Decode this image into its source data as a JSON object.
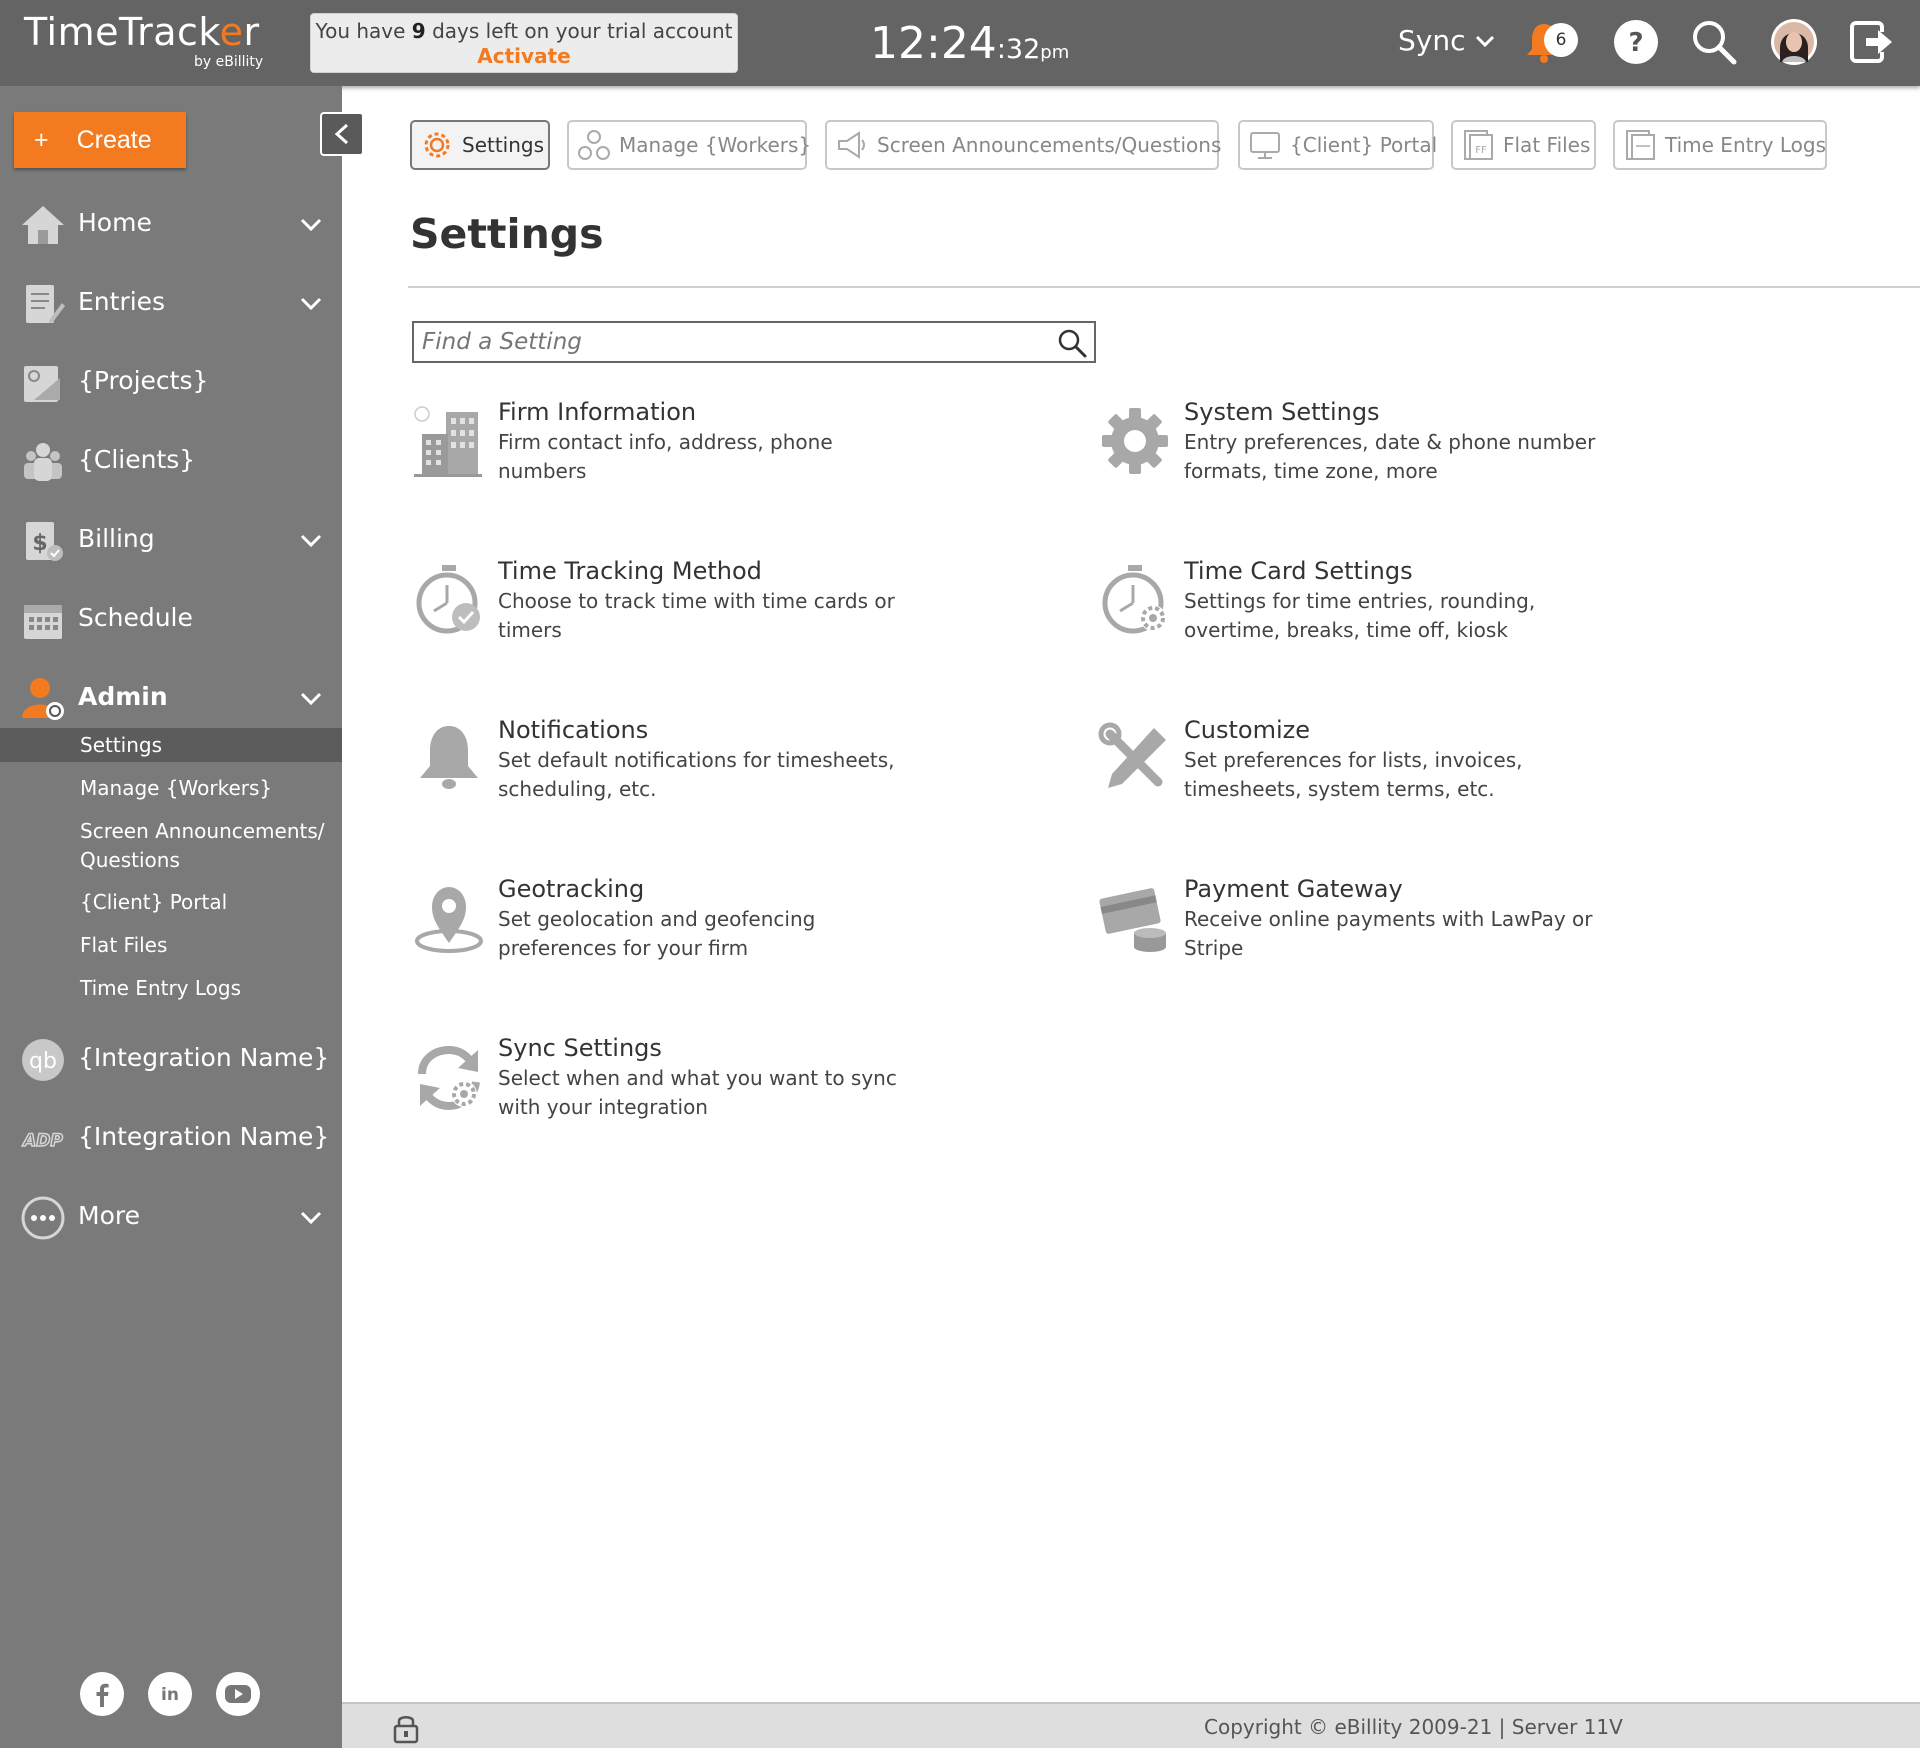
{
  "app": {
    "logo_text_a": "TimeTrack",
    "logo_text_accent": "e",
    "logo_text_b": "r",
    "logo_sub": "by eBillity"
  },
  "trial": {
    "prefix": "You have ",
    "days": "9",
    "suffix": " days left on your trial account",
    "activate": "Activate"
  },
  "clock": {
    "hm": "12:24",
    "sec": ":32",
    "ampm": "pm"
  },
  "topbar": {
    "sync_label": "Sync",
    "notification_count": "6",
    "icons": [
      "bell-icon",
      "help-icon",
      "search-icon",
      "avatar",
      "logout-icon"
    ]
  },
  "sidebar": {
    "create_label": "Create",
    "create_plus": "+",
    "items": [
      {
        "label": "Home",
        "icon": "home-icon",
        "chevron": true
      },
      {
        "label": "Entries",
        "icon": "entries-icon",
        "chevron": true
      },
      {
        "label": "{Projects}",
        "icon": "projects-icon",
        "chevron": false
      },
      {
        "label": "{Clients}",
        "icon": "clients-icon",
        "chevron": false
      },
      {
        "label": "Billing",
        "icon": "billing-icon",
        "chevron": true
      },
      {
        "label": "Schedule",
        "icon": "calendar-icon",
        "chevron": false
      },
      {
        "label": "Admin",
        "icon": "admin-icon",
        "chevron": true
      },
      {
        "label": "{Integration Name}",
        "icon": "quickbooks-icon",
        "chevron": false
      },
      {
        "label": "{Integration Name}",
        "icon": "adp-icon",
        "chevron": false
      },
      {
        "label": "More",
        "icon": "more-icon",
        "chevron": true
      }
    ],
    "admin_sub": [
      "Settings",
      "Manage {Workers}",
      "Screen Announcements/",
      "Questions",
      "{Client} Portal",
      "Flat Files",
      "Time Entry Logs"
    ],
    "socials": [
      "facebook-icon",
      "linkedin-icon",
      "youtube-icon"
    ]
  },
  "tabs": [
    {
      "label": "Settings",
      "active": true
    },
    {
      "label": "Manage {Workers}",
      "active": false
    },
    {
      "label": "Screen Announcements/Questions",
      "active": false
    },
    {
      "label": "{Client} Portal",
      "active": false
    },
    {
      "label": "Flat Files",
      "active": false
    },
    {
      "label": "Time Entry Logs",
      "active": false
    }
  ],
  "main": {
    "title": "Settings",
    "search_placeholder": "Find a Setting",
    "settings": [
      {
        "title": "Firm Information",
        "desc": "Firm contact info, address, phone numbers",
        "icon": "building-icon"
      },
      {
        "title": "System Settings",
        "desc": "Entry preferences, date & phone number formats, time zone, more",
        "icon": "gear-icon"
      },
      {
        "title": "Time Tracking Method",
        "desc": "Choose to track time with time cards or timers",
        "icon": "stopwatch-check-icon"
      },
      {
        "title": "Time Card Settings",
        "desc": "Settings for time entries, rounding, overtime, breaks, time off, kiosk",
        "icon": "stopwatch-gear-icon"
      },
      {
        "title": "Notifications",
        "desc": "Set default notifications for timesheets, scheduling, etc.",
        "icon": "bell-icon"
      },
      {
        "title": "Customize",
        "desc": "Set preferences for lists, invoices, timesheets, system terms, etc.",
        "icon": "tools-icon"
      },
      {
        "title": "Geotracking",
        "desc": "Set geolocation and geofencing preferences for your firm",
        "icon": "map-pin-icon"
      },
      {
        "title": "Payment Gateway",
        "desc": "Receive online payments with LawPay or Stripe",
        "icon": "credit-card-icon"
      },
      {
        "title": "Sync Settings",
        "desc": "Select when and what you want to sync with your integration",
        "icon": "sync-gear-icon"
      }
    ]
  },
  "footer": {
    "copyright": "Copyright © eBillity 2009-21 | Server 11V"
  },
  "colors": {
    "accent": "#f47a1f",
    "topbar": "#646464",
    "sidebar": "#7a7a7a",
    "icon_gray": "#9a9a9a"
  }
}
